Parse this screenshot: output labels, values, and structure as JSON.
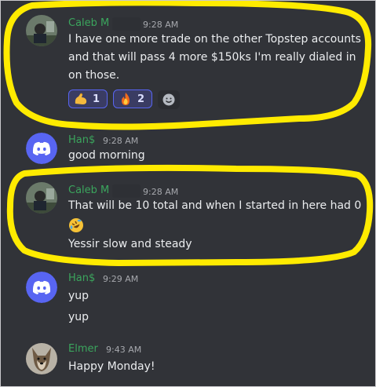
{
  "messages": [
    {
      "author": "Caleb M",
      "time": "9:28 AM",
      "avatar": "photo-avatar",
      "lines": [
        "I have one more trade on the other Topstep accounts",
        "and that will pass 4 more $150ks I'm really dialed in",
        "on those."
      ],
      "reactions": [
        {
          "emoji": "flexed-biceps",
          "count": "1"
        },
        {
          "emoji": "fire",
          "count": "2"
        }
      ]
    },
    {
      "author": "Han$",
      "time": "9:28 AM",
      "avatar": "discord-default-avatar",
      "lines": [
        "good morning"
      ]
    },
    {
      "author": "Caleb M",
      "time": "9:28 AM",
      "avatar": "photo-avatar",
      "lines": [
        "That will be 10 total and when I started in here had 0",
        "",
        "Yessir slow and steady"
      ],
      "emoji": "rolling-on-floor-laughing"
    },
    {
      "author": "Han$",
      "time": "9:29 AM",
      "avatar": "discord-default-avatar",
      "lines": [
        "yup",
        "yup"
      ]
    },
    {
      "author": "Elmer",
      "time": "9:43 AM",
      "avatar": "dog-photo-avatar",
      "lines": [
        "Happy Monday!"
      ]
    }
  ],
  "colors": {
    "background": "#313338",
    "username": "#3ba55d",
    "highlight": "#ffeb00",
    "discord_blurple": "#5865f2"
  }
}
